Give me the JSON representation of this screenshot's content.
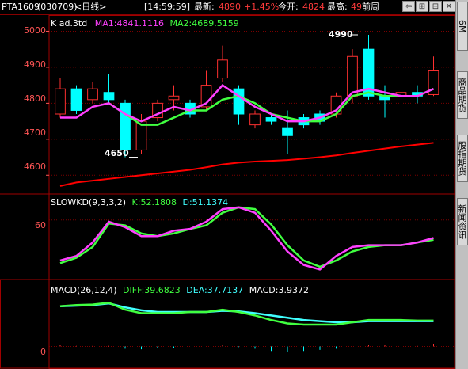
{
  "header": {
    "symbol": "PTA1609",
    "code": "(030709)",
    "period": "<日线>",
    "time": "[14:59:59]",
    "latest_label": "最新:",
    "latest_value": "4890",
    "change_pct": "+1.45%",
    "open_label": "今开:",
    "open_value": "4824",
    "high_label": "最高:",
    "high_value": "49",
    "prev_label": "前周",
    "btn_back": "⇦",
    "btn_plus": "⊞",
    "btn_minus": "⊟",
    "btn_close": "✕"
  },
  "sidebar": {
    "tabs": [
      "6M",
      "商品期货",
      "股指期货",
      "新闻资讯"
    ]
  },
  "colors": {
    "up": "#ff3030",
    "down": "#00ffff",
    "ma1": "#ff40ff",
    "ma2": "#40ff40",
    "ma_long": "#ff0000",
    "k": "#ff40ff",
    "d": "#40ff40",
    "diff": "#40ffff",
    "dea": "#ff40ff",
    "grid": "#7a0000"
  },
  "chart_data": [
    {
      "type": "candlestick",
      "title": "K ad.3td",
      "legend": [
        {
          "name": "MA1",
          "value": "4841.1116"
        },
        {
          "name": "MA2",
          "value": "4689.5159"
        }
      ],
      "y_ticks": [
        "5000",
        "4900",
        "4800",
        "4700",
        "4600"
      ],
      "ylim": [
        4550,
        5020
      ],
      "annotations": [
        {
          "text": "4990",
          "value": 4990
        },
        {
          "text": "4650",
          "value": 4650
        }
      ],
      "candles": [
        {
          "o": 4770,
          "c": 4840,
          "h": 4870,
          "l": 4760
        },
        {
          "o": 4840,
          "c": 4780,
          "h": 4850,
          "l": 4770
        },
        {
          "o": 4810,
          "c": 4840,
          "h": 4860,
          "l": 4800
        },
        {
          "o": 4830,
          "c": 4810,
          "h": 4880,
          "l": 4800
        },
        {
          "o": 4800,
          "c": 4670,
          "h": 4810,
          "l": 4650
        },
        {
          "o": 4670,
          "c": 4750,
          "h": 4770,
          "l": 4660
        },
        {
          "o": 4760,
          "c": 4800,
          "h": 4810,
          "l": 4750
        },
        {
          "o": 4810,
          "c": 4820,
          "h": 4850,
          "l": 4780
        },
        {
          "o": 4800,
          "c": 4770,
          "h": 4810,
          "l": 4760
        },
        {
          "o": 4790,
          "c": 4850,
          "h": 4890,
          "l": 4780
        },
        {
          "o": 4870,
          "c": 4920,
          "h": 4960,
          "l": 4860
        },
        {
          "o": 4840,
          "c": 4770,
          "h": 4850,
          "l": 4740
        },
        {
          "o": 4740,
          "c": 4770,
          "h": 4780,
          "l": 4730
        },
        {
          "o": 4760,
          "c": 4750,
          "h": 4770,
          "l": 4740
        },
        {
          "o": 4730,
          "c": 4710,
          "h": 4780,
          "l": 4660
        },
        {
          "o": 4760,
          "c": 4740,
          "h": 4770,
          "l": 4730
        },
        {
          "o": 4770,
          "c": 4750,
          "h": 4780,
          "l": 4740
        },
        {
          "o": 4770,
          "c": 4820,
          "h": 4830,
          "l": 4760
        },
        {
          "o": 4820,
          "c": 4930,
          "h": 4950,
          "l": 4800
        },
        {
          "o": 4950,
          "c": 4820,
          "h": 4990,
          "l": 4810
        },
        {
          "o": 4820,
          "c": 4810,
          "h": 4850,
          "l": 4760
        },
        {
          "o": 4820,
          "c": 4830,
          "h": 4850,
          "l": 4760
        },
        {
          "o": 4830,
          "c": 4820,
          "h": 4850,
          "l": 4800
        },
        {
          "o": 4824,
          "c": 4890,
          "h": 4930,
          "l": 4820
        }
      ],
      "ma1": [
        4760,
        4760,
        4790,
        4800,
        4770,
        4750,
        4770,
        4790,
        4780,
        4800,
        4850,
        4820,
        4790,
        4770,
        4750,
        4750,
        4760,
        4780,
        4830,
        4840,
        4830,
        4820,
        4820,
        4840
      ],
      "ma2": [
        null,
        null,
        null,
        4800,
        4770,
        4740,
        4740,
        4760,
        4780,
        4780,
        4810,
        4820,
        4800,
        4770,
        4760,
        4750,
        4750,
        4770,
        4820,
        4830,
        4820,
        4820,
        4820,
        4840
      ],
      "ma_long": [
        4570,
        4580,
        4585,
        4590,
        4595,
        4600,
        4605,
        4610,
        4615,
        4622,
        4630,
        4635,
        4638,
        4640,
        4642,
        4646,
        4650,
        4655,
        4662,
        4668,
        4674,
        4680,
        4685,
        4690
      ]
    },
    {
      "type": "line",
      "title": "SLOWKD(9,3,3,2)",
      "legend": [
        {
          "name": "K",
          "value": "52.1808"
        },
        {
          "name": "D",
          "value": "51.1374"
        }
      ],
      "y_ticks": [
        "60"
      ],
      "ylim": [
        0,
        80
      ],
      "K": [
        15,
        20,
        35,
        58,
        52,
        42,
        42,
        48,
        50,
        58,
        72,
        74,
        68,
        48,
        25,
        10,
        5,
        20,
        30,
        32,
        32,
        32,
        35,
        40
      ],
      "D": [
        12,
        18,
        30,
        56,
        54,
        45,
        42,
        45,
        50,
        54,
        68,
        74,
        72,
        55,
        32,
        15,
        8,
        15,
        25,
        30,
        32,
        32,
        35,
        38
      ]
    },
    {
      "type": "line",
      "title": "MACD(26,12,4)",
      "legend": [
        {
          "name": "DIFF",
          "value": "39.6823"
        },
        {
          "name": "DEA",
          "value": "37.7137"
        },
        {
          "name": "MACD",
          "value": "3.9372"
        }
      ],
      "y_ticks": [
        "0"
      ],
      "ylim": [
        -20,
        100
      ],
      "DIFF": [
        70,
        72,
        73,
        76,
        64,
        58,
        58,
        58,
        60,
        60,
        64,
        60,
        54,
        46,
        40,
        38,
        38,
        38,
        42,
        46,
        46,
        46,
        45,
        45
      ],
      "DEA": [
        70,
        71,
        72,
        75,
        68,
        63,
        60,
        60,
        60,
        60,
        62,
        61,
        58,
        54,
        50,
        46,
        44,
        42,
        42,
        44,
        44,
        44,
        44,
        44
      ],
      "MACD": [
        2,
        1,
        1,
        1,
        -4,
        -5,
        -2,
        -2,
        0,
        0,
        2,
        -1,
        -4,
        -8,
        -10,
        -8,
        -6,
        -4,
        0,
        2,
        2,
        2,
        1,
        4
      ]
    }
  ]
}
